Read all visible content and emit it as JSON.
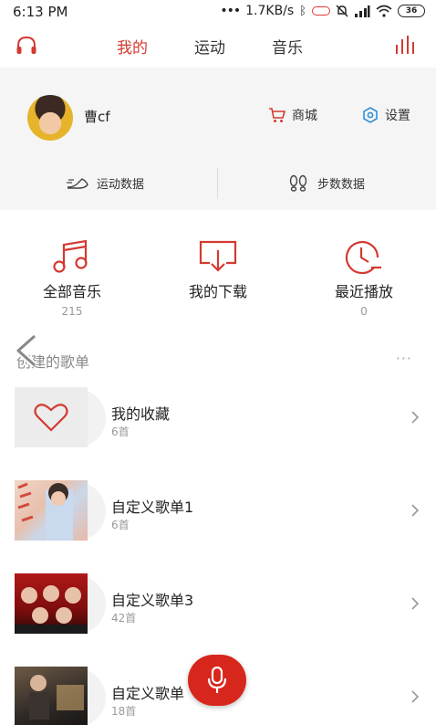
{
  "status_bar": {
    "time": "6:13 PM",
    "network_speed": "1.7KB/s",
    "battery": "36"
  },
  "top_nav": {
    "tabs": [
      {
        "label": "我的",
        "active": true
      },
      {
        "label": "运动",
        "active": false
      },
      {
        "label": "音乐",
        "active": false
      }
    ],
    "accent_color": "#d33a31"
  },
  "profile": {
    "username": "曹cf",
    "shop_label": "商城",
    "settings_label": "设置",
    "sport_data_label": "运动数据",
    "step_data_label": "步数数据"
  },
  "quick_entries": [
    {
      "label": "全部音乐",
      "count": "215",
      "icon": "music-note-icon"
    },
    {
      "label": "我的下载",
      "count": "",
      "icon": "download-icon"
    },
    {
      "label": "最近播放",
      "count": "0",
      "icon": "clock-icon"
    }
  ],
  "section": {
    "title": "创建的歌单",
    "more": "···"
  },
  "playlists": [
    {
      "name": "我的收藏",
      "count": "6首"
    },
    {
      "name": "自定义歌单1",
      "count": "6首"
    },
    {
      "name": "自定义歌单3",
      "count": "42首"
    },
    {
      "name": "自定义歌单",
      "count": "18首"
    }
  ]
}
